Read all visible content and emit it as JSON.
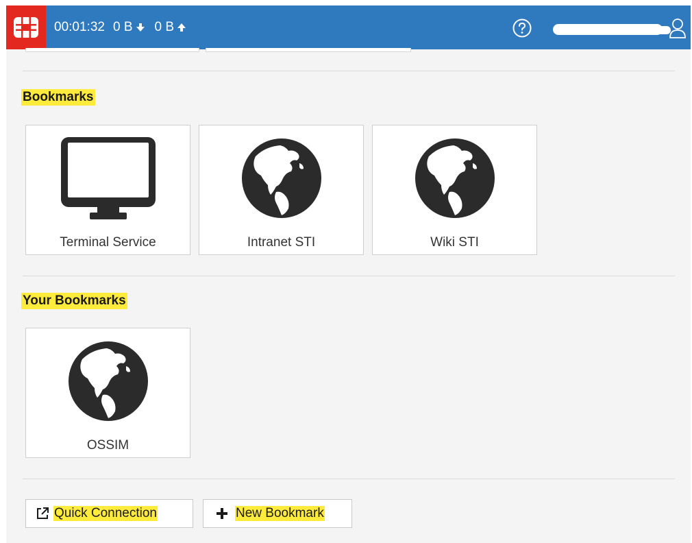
{
  "header": {
    "timer": "00:01:32",
    "download": "0 B",
    "upload": "0 B",
    "icons": {
      "logo": "fortinet-logo-icon",
      "download": "arrow-down-icon",
      "upload": "arrow-up-icon",
      "help": "help-circle-icon",
      "user": "user-icon"
    },
    "colors": {
      "bar": "#2f79bf",
      "logo_bg": "#e2281f"
    }
  },
  "bookmarks": {
    "title": "Bookmarks",
    "items": [
      {
        "label": "Terminal Service",
        "icon": "monitor-icon"
      },
      {
        "label": "Intranet STI",
        "icon": "globe-icon"
      },
      {
        "label": "Wiki STI",
        "icon": "globe-icon"
      }
    ]
  },
  "your_bookmarks": {
    "title": "Your Bookmarks",
    "items": [
      {
        "label": "OSSIM",
        "icon": "globe-icon"
      }
    ]
  },
  "actions": {
    "quick_connection": "Quick Connection",
    "new_bookmark": "New Bookmark",
    "icons": {
      "quick_connection": "external-link-icon",
      "new_bookmark": "plus-icon"
    }
  },
  "highlight_color": "#ffeb3b"
}
